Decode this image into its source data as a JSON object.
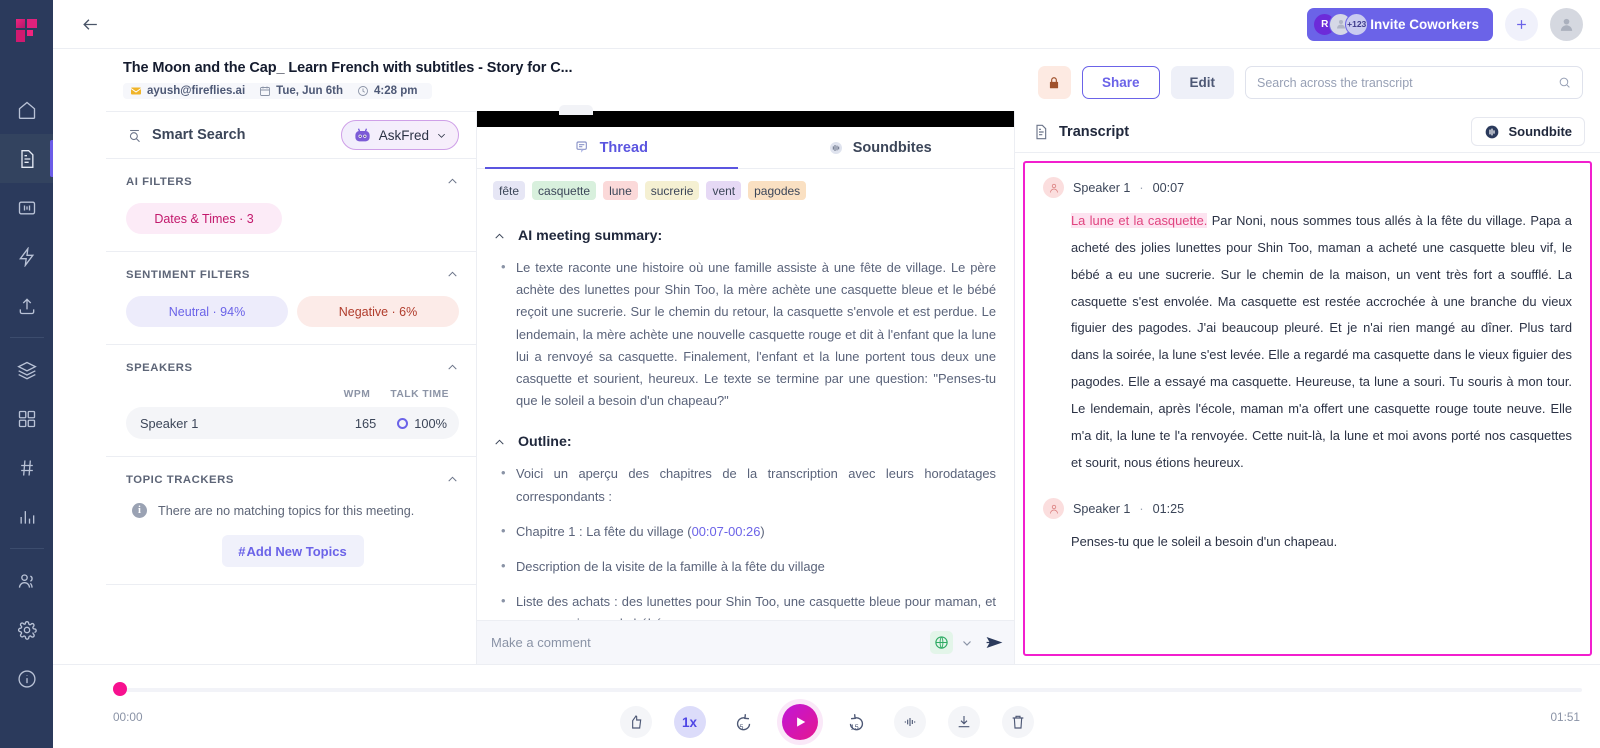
{
  "brand": {
    "accent": "#6b63e8",
    "pink": "#f21fce",
    "rail_bg": "#2b3a5c"
  },
  "rail": {
    "items": [
      {
        "name": "home-icon",
        "label": "Home"
      },
      {
        "name": "notepad-icon",
        "label": "Notes"
      },
      {
        "name": "meeting-icon",
        "label": "Meetings"
      },
      {
        "name": "bolt-icon",
        "label": "Automation"
      },
      {
        "name": "upload-icon",
        "label": "Upload"
      },
      {
        "name": "layers-icon",
        "label": "Channels"
      },
      {
        "name": "apps-icon",
        "label": "Apps"
      },
      {
        "name": "hash-icon",
        "label": "Topics"
      },
      {
        "name": "analytics-icon",
        "label": "Analytics"
      },
      {
        "name": "team-icon",
        "label": "Team"
      },
      {
        "name": "gear-icon",
        "label": "Settings"
      },
      {
        "name": "info-icon",
        "label": "Help"
      }
    ]
  },
  "topbar": {
    "invite_label": "Invite Coworkers",
    "avatar_initial": "R",
    "avatar_count": "+123",
    "plus_label": "+"
  },
  "header": {
    "title": "The Moon and the Cap_ Learn French with subtitles - Story for C...",
    "email": "ayush@fireflies.ai",
    "date": "Tue, Jun 6th",
    "time": "4:28 pm",
    "share_label": "Share",
    "edit_label": "Edit"
  },
  "search": {
    "placeholder": "Search across the transcript",
    "value": ""
  },
  "filters": {
    "smart_search_label": "Smart Search",
    "askfred_label": "AskFred",
    "ai_filters_title": "AI FILTERS",
    "ai_chips": [
      {
        "label": "Dates & Times · 3"
      }
    ],
    "sentiment_title": "SENTIMENT FILTERS",
    "sentiment_chips": [
      {
        "label": "Neutral · 94%"
      },
      {
        "label": "Negative · 6%"
      }
    ],
    "speakers_title": "SPEAKERS",
    "speakers_cols": {
      "wpm": "WPM",
      "talk_time": "TALK TIME"
    },
    "speakers": [
      {
        "name": "Speaker 1",
        "wpm": "165",
        "talk_time": "100%"
      }
    ],
    "topics_title": "TOPIC TRACKERS",
    "topics_empty": "There are no matching topics for this meeting.",
    "add_topics_label": "Add New Topics"
  },
  "thread": {
    "tabs": [
      {
        "label": "Thread",
        "icon": "thread-icon",
        "active": true
      },
      {
        "label": "Soundbites",
        "icon": "soundbite-icon",
        "active": false
      }
    ],
    "keywords": [
      {
        "label": "fête",
        "color": "#e6e6f5"
      },
      {
        "label": "casquette",
        "color": "#d8f0dd"
      },
      {
        "label": "lune",
        "color": "#fbd9d9"
      },
      {
        "label": "sucrerie",
        "color": "#f5f0d2"
      },
      {
        "label": "vent",
        "color": "#e6d9f5"
      },
      {
        "label": "pagodes",
        "color": "#fae0c2"
      }
    ],
    "summary_title": "AI meeting summary:",
    "summary_bullets": [
      "Le texte raconte une histoire où une famille assiste à une fête de village. Le père achète des lunettes pour Shin Too, la mère achète une casquette bleue et le bébé reçoit une sucrerie. Sur le chemin du retour, la casquette s'envole et est perdue. Le lendemain, la mère achète une nouvelle casquette rouge et dit à l'enfant que la lune lui a renvoyé sa casquette. Finalement, l'enfant et la lune portent tous deux une casquette et sourient, heureux. Le texte se termine par une question: \"Penses-tu que le soleil a besoin d'un chapeau?\""
    ],
    "outline_title": "Outline:",
    "outline_bullets": [
      {
        "text": "Voici un aperçu des chapitres de la transcription avec leurs horodatages correspondants :"
      },
      {
        "text": "Chapitre 1 : La fête du village (",
        "timestamp": "00:07-00:26",
        "after": ")"
      },
      {
        "text": "Description de la visite de la famille à la fête du village"
      },
      {
        "text": "Liste des achats : des lunettes pour Shin Too, une casquette bleue pour maman, et une sucrerie pour le bébé"
      }
    ],
    "comment_placeholder": "Make a comment"
  },
  "transcript": {
    "title": "Transcript",
    "soundbite_label": "Soundbite",
    "blocks": [
      {
        "speaker": "Speaker 1",
        "time": "00:07",
        "highlight": "La lune et la casquette.",
        "text": " Par Noni, nous sommes tous allés à la fête du village. Papa a acheté des jolies lunettes pour Shin Too, maman a acheté une casquette bleu vif, le bébé a eu une sucrerie. Sur le chemin de la maison, un vent très fort a soufflé. La casquette s'est envolée. Ma casquette est restée accrochée à une branche du vieux figuier des pagodes. J'ai beaucoup pleuré. Et je n'ai rien mangé au dîner. Plus tard dans la soirée, la lune s'est levée. Elle a regardé ma casquette dans le vieux figuier des pagodes. Elle a essayé ma casquette. Heureuse, ta lune a souri. Tu souris à mon tour. Le lendemain, après l'école, maman m'a offert une casquette rouge toute neuve. Elle m'a dit, la lune te l'a renvoyée. Cette nuit-là, la lune et moi avons porté nos casquettes et sourit, nous étions heureux."
      },
      {
        "speaker": "Speaker 1",
        "time": "01:25",
        "highlight": "",
        "text": "Penses-tu que le soleil a besoin d'un chapeau."
      }
    ]
  },
  "player": {
    "current_time": "00:00",
    "total_time": "01:51",
    "speed_label": "1x",
    "rewind_label": "5",
    "forward_label": "15",
    "controls": [
      "thumbs-up-icon",
      "speed-button",
      "rewind-5-icon",
      "play-button",
      "forward-15-icon",
      "waveform-icon",
      "download-icon",
      "trash-icon"
    ]
  }
}
